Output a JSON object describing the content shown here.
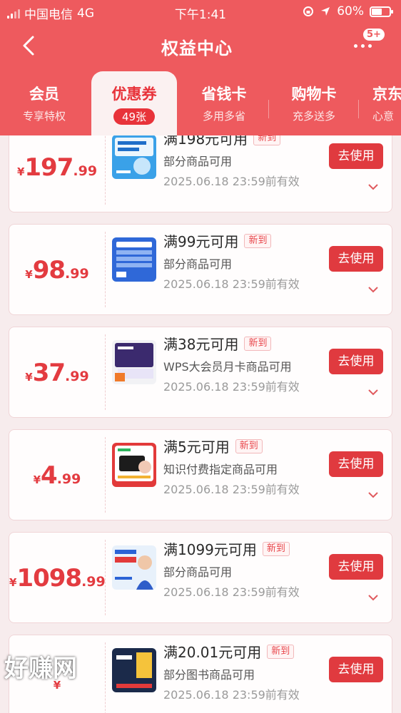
{
  "status_bar": {
    "carrier": "中国电信",
    "network": "4G",
    "time": "下午1:41",
    "battery": "60%",
    "battery_level": 0.6
  },
  "navbar": {
    "title": "权益中心",
    "badge": "5+"
  },
  "tabs": [
    {
      "label": "会员",
      "sub": "专享特权"
    },
    {
      "label": "优惠券",
      "sub": "49张"
    },
    {
      "label": "省钱卡",
      "sub": "多用多省"
    },
    {
      "label": "购物卡",
      "sub": "充多送多"
    },
    {
      "label": "京东",
      "sub": "心意"
    }
  ],
  "coupons": [
    {
      "yen": "¥",
      "int": "197",
      "dec": ".99",
      "title": "满198元可用",
      "tag": "新到",
      "desc": "部分商品可用",
      "expiry": "2025.06.18 23:59前有效",
      "button": "去使用",
      "thumb": "ai-course"
    },
    {
      "yen": "¥",
      "int": "98",
      "dec": ".99",
      "title": "满99元可用",
      "tag": "新到",
      "desc": "部分商品可用",
      "expiry": "2025.06.18 23:59前有效",
      "button": "去使用",
      "thumb": "ai-book"
    },
    {
      "yen": "¥",
      "int": "37",
      "dec": ".99",
      "title": "满38元可用",
      "tag": "新到",
      "desc": "WPS大会员月卡商品可用",
      "expiry": "2025.06.18 23:59前有效",
      "button": "去使用",
      "thumb": "wps"
    },
    {
      "yen": "¥",
      "int": "4",
      "dec": ".99",
      "title": "满5元可用",
      "tag": "新到",
      "desc": "知识付费指定商品可用",
      "expiry": "2025.06.18 23:59前有效",
      "button": "去使用",
      "thumb": "knowledge"
    },
    {
      "yen": "¥",
      "int": "1098",
      "dec": ".99",
      "title": "满1099元可用",
      "tag": "新到",
      "desc": "部分商品可用",
      "expiry": "2025.06.18 23:59前有效",
      "button": "去使用",
      "thumb": "ai-era"
    },
    {
      "yen": "¥",
      "int": "",
      "dec": "",
      "title": "满20.01元可用",
      "tag": "新到",
      "desc": "部分图书商品可用",
      "expiry": "2025.06.18 23:59前有效",
      "button": "去使用",
      "thumb": "book"
    }
  ],
  "watermark": "好赚网"
}
